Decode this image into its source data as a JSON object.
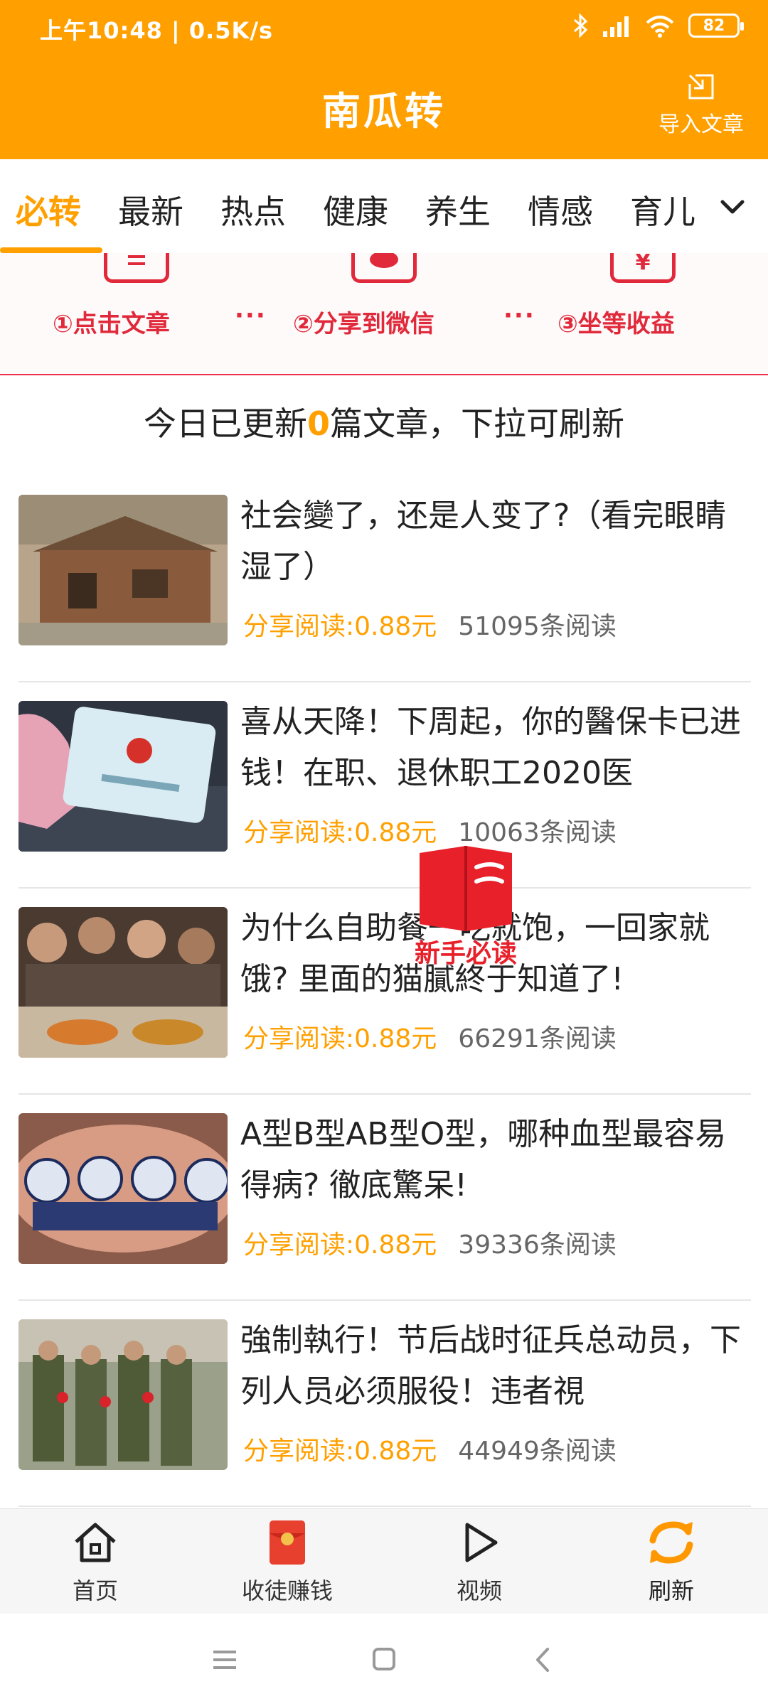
{
  "status_bar": {
    "time": "上午10:48 | 0.5K/s",
    "battery": "82"
  },
  "header": {
    "title": "南瓜转",
    "import_label": "导入文章"
  },
  "tabs": [
    {
      "label": "必转",
      "active": true
    },
    {
      "label": "最新"
    },
    {
      "label": "热点"
    },
    {
      "label": "健康"
    },
    {
      "label": "养生"
    },
    {
      "label": "情感"
    },
    {
      "label": "育儿"
    }
  ],
  "banner": {
    "steps": [
      "①点击文章",
      "②分享到微信",
      "③坐等收益"
    ],
    "separator": "···",
    "money_symbol": "¥"
  },
  "notice": {
    "prefix": "今日已更新",
    "count": "0",
    "suffix": "篇文章，下拉可刷新"
  },
  "articles": [
    {
      "title": "社会變了，还是人变了?（看完眼睛湿了）",
      "price": "分享阅读:0.88元",
      "reads": "51095条阅读",
      "thumb_icon": "old-house-image"
    },
    {
      "title": "喜从天降！下周起，你的醫保卡已进钱！在职、退休职工2020医",
      "price": "分享阅读:0.88元",
      "reads": "10063条阅读",
      "thumb_icon": "social-security-card-image"
    },
    {
      "title": "为什么自助餐一吃就饱，一回家就饿? 里面的猫膩終于知道了!",
      "price": "分享阅读:0.88元",
      "reads": "66291条阅读",
      "thumb_icon": "buffet-crowd-image"
    },
    {
      "title": "A型B型AB型O型，哪种血型最容易得病? 徹底驚呆!",
      "price": "分享阅读:0.88元",
      "reads": "39336条阅读",
      "thumb_icon": "blood-type-image"
    },
    {
      "title": "強制執行！节后战时征兵总动员，下列人员必须服役！违者視",
      "price": "分享阅读:0.88元",
      "reads": "44949条阅读",
      "thumb_icon": "soldiers-image"
    }
  ],
  "beginner_badge": {
    "label": "新手必读"
  },
  "bottom_nav": [
    {
      "label": "首页",
      "icon": "home-icon"
    },
    {
      "label": "收徒赚钱",
      "icon": "red-envelope-icon"
    },
    {
      "label": "视频",
      "icon": "play-icon"
    },
    {
      "label": "刷新",
      "icon": "refresh-icon"
    }
  ],
  "colors": {
    "brand": "#ffa000",
    "banner_red": "#e0293b",
    "badge_red": "#e8202a"
  }
}
